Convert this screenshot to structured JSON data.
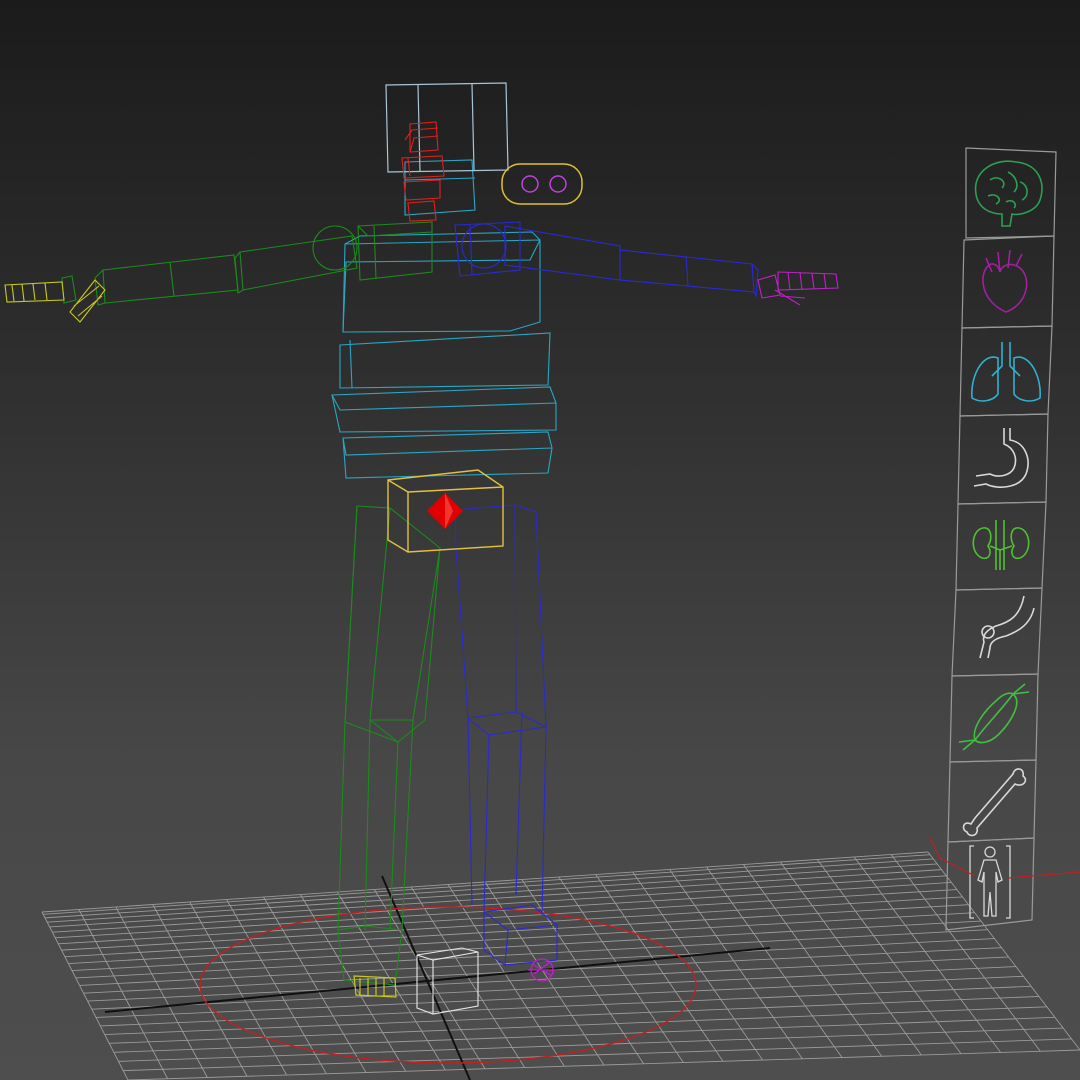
{
  "viewport": {
    "name": "perspective-viewport",
    "background_top": "#1b1b1b",
    "background_bottom": "#4e4e4e",
    "grid_color": "#9a9a9a",
    "grid_axis_color": "#101010"
  },
  "rig": {
    "colors": {
      "head": "#a8c4d8",
      "neck": "#e0201e",
      "spine": "#2aa6c4",
      "left_arm": "#1c8a1c",
      "right_arm": "#2a2ad0",
      "left_hand": "#c8c820",
      "right_hand": "#c020c8",
      "left_leg": "#1c8a1c",
      "right_leg": "#2a2ad0",
      "pelvis": "#e2c040",
      "root_marker": "#e00000",
      "ground_circle": "#c02020",
      "facial_control": "#e0c030",
      "facial_eyes": "#c040e0",
      "floor_box": "#e8e8e8"
    }
  },
  "organ_panel": {
    "frame_color": "#9a9a9a",
    "icons": [
      {
        "name": "brain-icon",
        "color": "#2aa050"
      },
      {
        "name": "heart-icon",
        "color": "#a020a0"
      },
      {
        "name": "lungs-icon",
        "color": "#30b0d0"
      },
      {
        "name": "stomach-icon",
        "color": "#d8d8d8"
      },
      {
        "name": "kidneys-icon",
        "color": "#50c030"
      },
      {
        "name": "nerve-icon",
        "color": "#d8d8d8"
      },
      {
        "name": "muscle-icon",
        "color": "#40c040"
      },
      {
        "name": "bone-icon",
        "color": "#d8d8d8"
      },
      {
        "name": "full-body-icon",
        "color": "#d8d8d8"
      }
    ]
  }
}
